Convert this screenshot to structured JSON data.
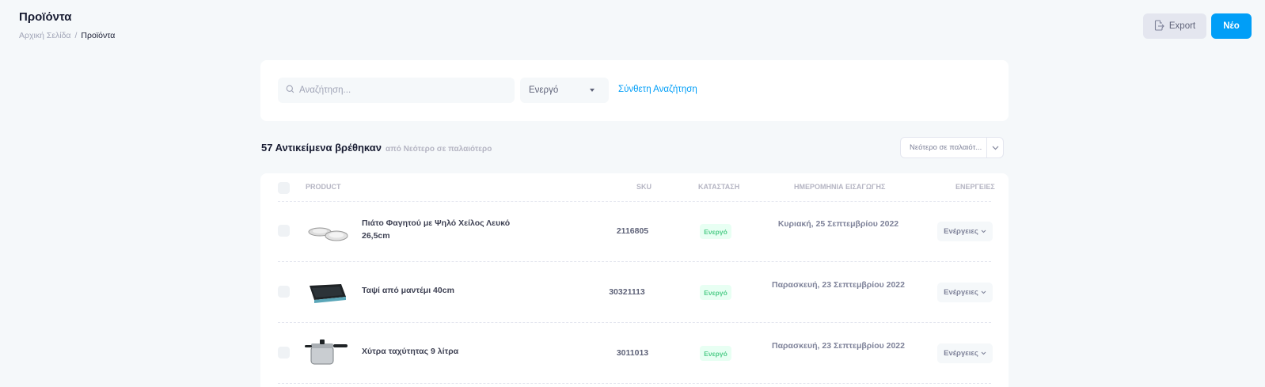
{
  "header": {
    "title": "Προϊόντα",
    "breadcrumb": {
      "home": "Αρχική Σελίδα",
      "separator": "/",
      "current": "Προϊόντα"
    }
  },
  "toolbar": {
    "export_label": "Export",
    "new_label": "Νέο"
  },
  "search": {
    "placeholder": "Αναζήτηση...",
    "status_value": "Ενεργό",
    "advanced_link": "Σύνθετη Αναζήτηση"
  },
  "results": {
    "count_text": "57 Αντικείμενα βρέθηκαν",
    "sort_text": "από Νεότερο σε παλαιότερο",
    "sort_select_value": "Νεότερο σε παλαιότ..."
  },
  "table": {
    "columns": {
      "product": "PRODUCT",
      "sku": "SKU",
      "status": "ΚΑΤΑΣΤΑΣΗ",
      "date": "ΗΜΕΡΟΜΗΝΙΑ ΕΙΣΑΓΩΓΗΣ",
      "actions": "ΕΝΕΡΓΕΙΕΣ"
    },
    "rows": [
      {
        "name": "Πιάτο Φαγητού με Ψηλό Χείλος Λευκό 26,5cm",
        "sku": "2116805",
        "status": "Ενεργό",
        "date": "Κυριακή, 25 Σεπτεμβρίου 2022",
        "actions": "Ενέργειες",
        "icon": "plate-image"
      },
      {
        "name": "Ταψί από μαντέμι 40cm",
        "sku": "30321113",
        "status": "Ενεργό",
        "date": "Παρασκευή, 23 Σεπτεμβρίου 2022",
        "actions": "Ενέργειες",
        "icon": "baking-pan-image"
      },
      {
        "name": "Χύτρα ταχύτητας 9 λίτρα",
        "sku": "3011013",
        "status": "Ενεργό",
        "date": "Παρασκευή, 23 Σεπτεμβρίου 2022",
        "actions": "Ενέργειες",
        "icon": "pressure-cooker-image"
      }
    ]
  },
  "colors": {
    "primary": "#009ef7",
    "success": "#50cd89",
    "success_light": "#e8fff3",
    "background": "#f5f8fa"
  }
}
